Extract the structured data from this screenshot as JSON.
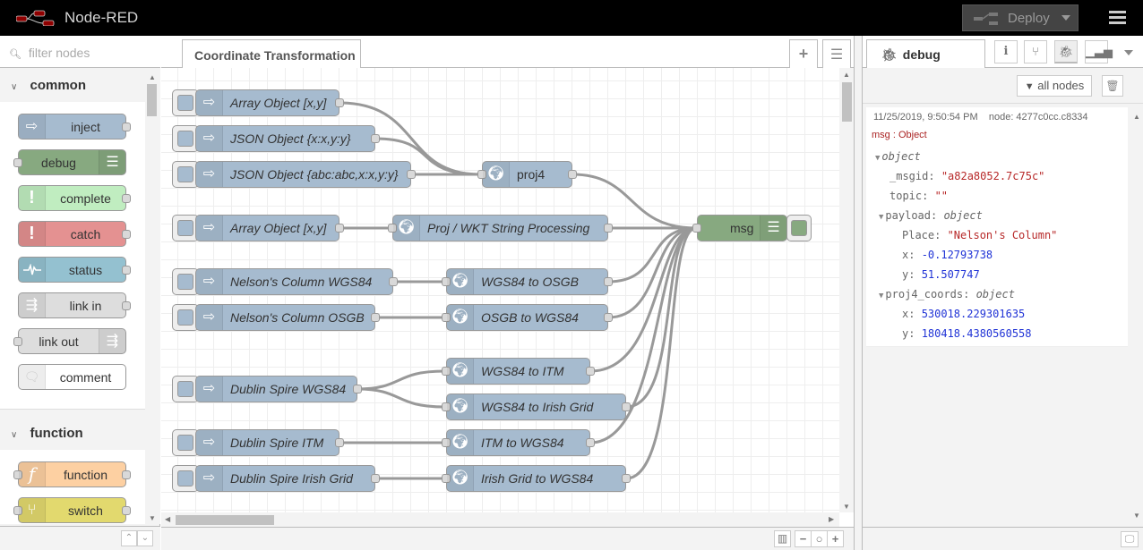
{
  "header": {
    "app_title": "Node-RED",
    "deploy_label": "Deploy"
  },
  "palette": {
    "filter_placeholder": "filter nodes",
    "categories": [
      {
        "name": "common",
        "nodes": [
          {
            "label": "inject",
            "icon": "arrow-right-icon",
            "color": "#a6bbcf"
          },
          {
            "label": "debug",
            "icon": "list-icon",
            "color": "#87a980"
          },
          {
            "label": "complete",
            "icon": "exclamation-icon",
            "color": "#c0edc0"
          },
          {
            "label": "catch",
            "icon": "exclamation-icon",
            "color": "#e49191"
          },
          {
            "label": "status",
            "icon": "pulse-icon",
            "color": "#94c1d0"
          },
          {
            "label": "link in",
            "icon": "link-in-icon",
            "color": "#dddddd"
          },
          {
            "label": "link out",
            "icon": "link-out-icon",
            "color": "#dddddd"
          },
          {
            "label": "comment",
            "icon": "comment-icon",
            "color": "#ffffff"
          }
        ]
      },
      {
        "name": "function",
        "nodes": [
          {
            "label": "function",
            "icon": "function-icon",
            "color": "#fdd0a2"
          },
          {
            "label": "switch",
            "icon": "switch-icon",
            "color": "#e2d96e"
          }
        ]
      }
    ]
  },
  "workspace": {
    "active_tab": "Coordinate Transformation",
    "nodes": {
      "inj_array1": "Array Object [x,y]",
      "inj_json1": "JSON Object {x:x,y:y}",
      "inj_json2": "JSON Object {abc:abc,x:x,y:y}",
      "proj4": "proj4",
      "inj_array2": "Array Object [x,y]",
      "proj_wkt": "Proj / WKT String Processing",
      "debug_msg": "msg",
      "inj_nelson_wgs": "Nelson's Column WGS84",
      "wgs_osgb": "WGS84 to OSGB",
      "inj_nelson_osgb": "Nelson's Column OSGB",
      "osgb_wgs": "OSGB to WGS84",
      "inj_dublin_wgs": "Dublin Spire WGS84",
      "wgs_itm": "WGS84 to ITM",
      "wgs_irish": "WGS84 to Irish Grid",
      "inj_dublin_itm": "Dublin Spire ITM",
      "itm_wgs": "ITM to WGS84",
      "inj_dublin_irish": "Dublin Spire Irish Grid",
      "irish_wgs": "Irish Grid to WGS84"
    }
  },
  "sidebar": {
    "active_tab": "debug",
    "filter_label": "all nodes",
    "message": {
      "timestamp": "11/25/2019, 9:50:54 PM",
      "node": "node: 4277c0cc.c8334",
      "type": "msg : Object",
      "root": "object",
      "msgid_key": "_msgid",
      "msgid_val": "\"a82a8052.7c75c\"",
      "topic_key": "topic",
      "topic_val": "\"\"",
      "payload_key": "payload",
      "payload_type": "object",
      "place_key": "Place",
      "place_val": "\"Nelson's Column\"",
      "px_key": "x",
      "px_val": "-0.12793738",
      "py_key": "y",
      "py_val": "51.507747",
      "coords_key": "proj4_coords",
      "coords_type": "object",
      "cx_key": "x",
      "cx_val": "530018.229301635",
      "cy_key": "y",
      "cy_val": "180418.4380560558"
    }
  }
}
